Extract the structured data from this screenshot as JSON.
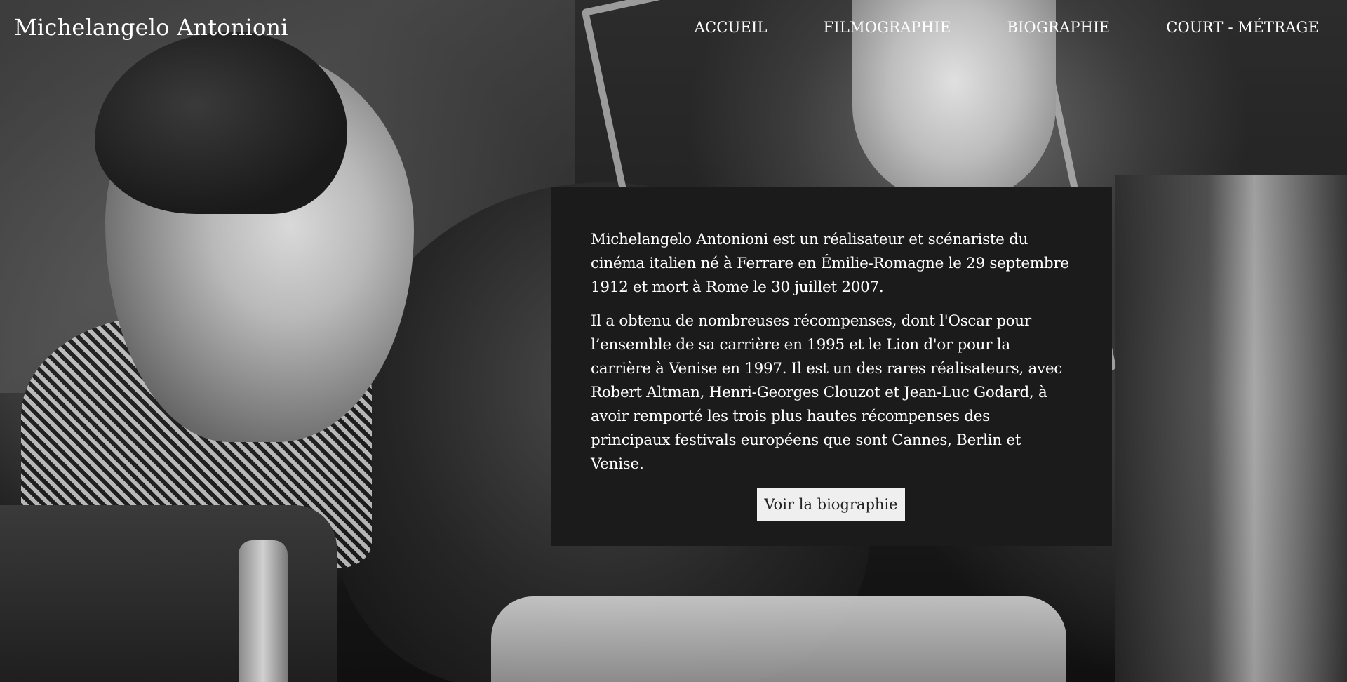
{
  "header": {
    "site_title": "Michelangelo Antonioni",
    "nav": [
      {
        "label": "ACCUEIL"
      },
      {
        "label": "FILMOGRAPHIE"
      },
      {
        "label": "BIOGRAPHIE"
      },
      {
        "label": "COURT - MÉTRAGE"
      }
    ]
  },
  "intro": {
    "paragraph_1": "Michelangelo Antonioni est un réalisateur et scénariste du cinéma italien né à Ferrare en Émilie-Romagne le 29 septembre 1912 et mort à Rome le 30 juillet 2007.",
    "paragraph_2": "Il a obtenu de nombreuses récompenses, dont l'Oscar pour l’ensemble de sa carrière en 1995 et le Lion d'or pour la carrière à Venise en 1997. Il est un des rares réalisateurs, avec Robert Altman, Henri-Georges Clouzot et Jean-Luc Godard, à avoir remporté les trois plus hautes récompenses des principaux festivals européens que sont Cannes, Berlin et Venise.",
    "button_label": "Voir la biographie"
  },
  "colors": {
    "card_background": "#1b1b1b",
    "text_light": "#ffffff",
    "button_background": "#efefef"
  }
}
